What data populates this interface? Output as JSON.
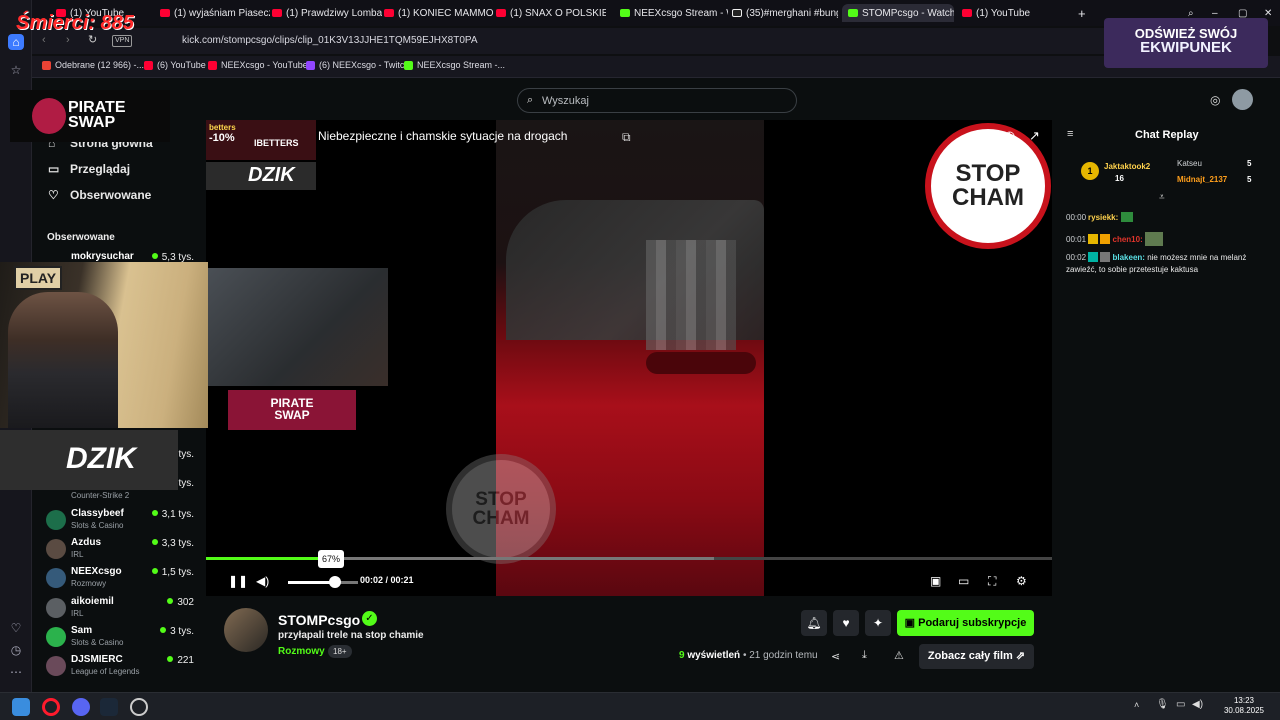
{
  "browser": {
    "tabs": [
      {
        "label": "(1) YouTube"
      },
      {
        "label": "(1) wyjaśniam Piaseczno"
      },
      {
        "label": "(1) Prawdziwy Lombard -"
      },
      {
        "label": "(1) KONIEC MAMMONA W"
      },
      {
        "label": "(1) SNAX O POLSKIEJ SCE"
      },
      {
        "label": "NEEXcsgo Stream - Watch"
      },
      {
        "label": "(35)#merghani #bungee"
      },
      {
        "label": "STOMPcsgo - Watch"
      },
      {
        "label": "(1) YouTube"
      }
    ],
    "vpn": "VPN",
    "url": "kick.com/stompcsgo/clips/clip_01K3V13JJHE1TQM59EJHX8T0PA",
    "bookmarks": [
      {
        "label": "Odebrane (12 966) -...",
        "color": "#ea4335"
      },
      {
        "label": "(6) YouTube",
        "color": "#ff0033"
      },
      {
        "label": "NEEXcsgo - YouTube",
        "color": "#ff0033"
      },
      {
        "label": "(6) NEEXcsgo - Twitch",
        "color": "#9146ff"
      },
      {
        "label": "NEEXcsgo Stream -...",
        "color": "#53fc18"
      }
    ]
  },
  "overlays": {
    "deaths": "Śmierci: 885",
    "pirate_line1": "PIRATE",
    "pirate_line2": "SWAP",
    "dzik": "DZIK",
    "play": "PLAY",
    "ekwipunek_line1": "ODŚWIEŻ SWÓJ",
    "ekwipunek_line2": "EKWIPUNEK"
  },
  "search": {
    "placeholder": "Wyszukaj"
  },
  "sidebar": {
    "nav": [
      {
        "label": "Strona główna"
      },
      {
        "label": "Przeglądaj"
      },
      {
        "label": "Obserwowane"
      }
    ],
    "following_header": "Obserwowane",
    "channels": [
      {
        "name": "mokrysuchar",
        "category": "",
        "viewers": "5,3 tys."
      },
      {
        "name": "",
        "category": "",
        "viewers": "tys."
      },
      {
        "name": "",
        "category": "",
        "viewers": "tys."
      },
      {
        "name": "",
        "category": "Counter-Strike 2",
        "viewers": ""
      },
      {
        "name": "Classybeef",
        "category": "Slots & Casino",
        "viewers": "3,1 tys."
      },
      {
        "name": "Azdus",
        "category": "IRL",
        "viewers": "3,3 tys."
      },
      {
        "name": "NEEXcsgo",
        "category": "Rozmowy",
        "viewers": "1,5 tys."
      },
      {
        "name": "aikoiemil",
        "category": "IRL",
        "viewers": "302"
      },
      {
        "name": "Sam",
        "category": "Slots & Casino",
        "viewers": "3 tys."
      },
      {
        "name": "DJSMIERC",
        "category": "League of Legends",
        "viewers": "221"
      }
    ]
  },
  "video": {
    "title": "Niebezpieczne i chamskie sytuacje na drogach",
    "stop_line1": "STOP",
    "stop_line2": "CHAM",
    "betters_text": "betters",
    "betters_promo": "-10%",
    "betters_code": "IBETTERS",
    "progress_fraction": 0.15,
    "volume_fraction": 0.67,
    "volume_tooltip": "67%",
    "current_time": "00:02",
    "duration": "00:21"
  },
  "clip": {
    "channel": "STOMPcsgo",
    "title": "przyłapali trele na stop chamie",
    "category": "Rozmowy",
    "age_badge": "18+",
    "views_count": "9",
    "views_label": "wyświetleń",
    "age": "• 21 godzin temu",
    "subscribe_label": "Podaruj subskrypcje",
    "full_video_label": "Zobacz cały film"
  },
  "chat": {
    "title": "Chat Replay",
    "leader": {
      "rank": "1",
      "name": "Jaktaktook2",
      "count": "16"
    },
    "top": [
      {
        "name": "Katseu",
        "count": "5",
        "color": "#cfd2d5"
      },
      {
        "name": "Midnajt_2137",
        "count": "5",
        "color": "#ff9f1c"
      }
    ],
    "messages": [
      {
        "time": "00:00",
        "user": "rysiekk:",
        "color": "#ffd24d",
        "text": ""
      },
      {
        "time": "00:01",
        "user": "chen10:",
        "color": "#e0342b",
        "text": ""
      },
      {
        "time": "00:02",
        "user": "blakeen:",
        "color": "#5be1e6",
        "text": "nie możesz mnie na melanż zawieźć, to sobie przetestuje kaktusa"
      }
    ]
  },
  "clock": {
    "time": "13:23",
    "date": "30.08.2025"
  }
}
